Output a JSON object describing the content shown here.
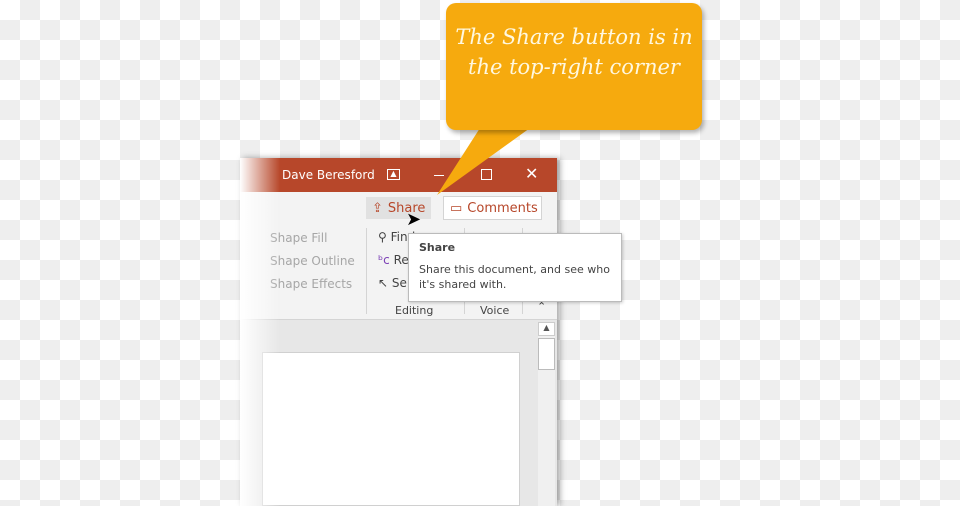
{
  "callout": {
    "text": "The Share button is in the top-right corner",
    "color": "#f6aa0e"
  },
  "titlebar": {
    "user": "Dave Beresford",
    "color": "#b7472a"
  },
  "toolbar": {
    "share_label": "Share",
    "comments_label": "Comments"
  },
  "ribbon": {
    "drawing": [
      "Shape Fill",
      "Shape Outline",
      "Shape Effects"
    ],
    "editing": [
      "Find",
      "Replace",
      "Select"
    ],
    "groups": {
      "editing": "Editing",
      "voice": "Voice"
    }
  },
  "tooltip": {
    "title": "Share",
    "body": "Share this document, and see who it's shared with."
  }
}
